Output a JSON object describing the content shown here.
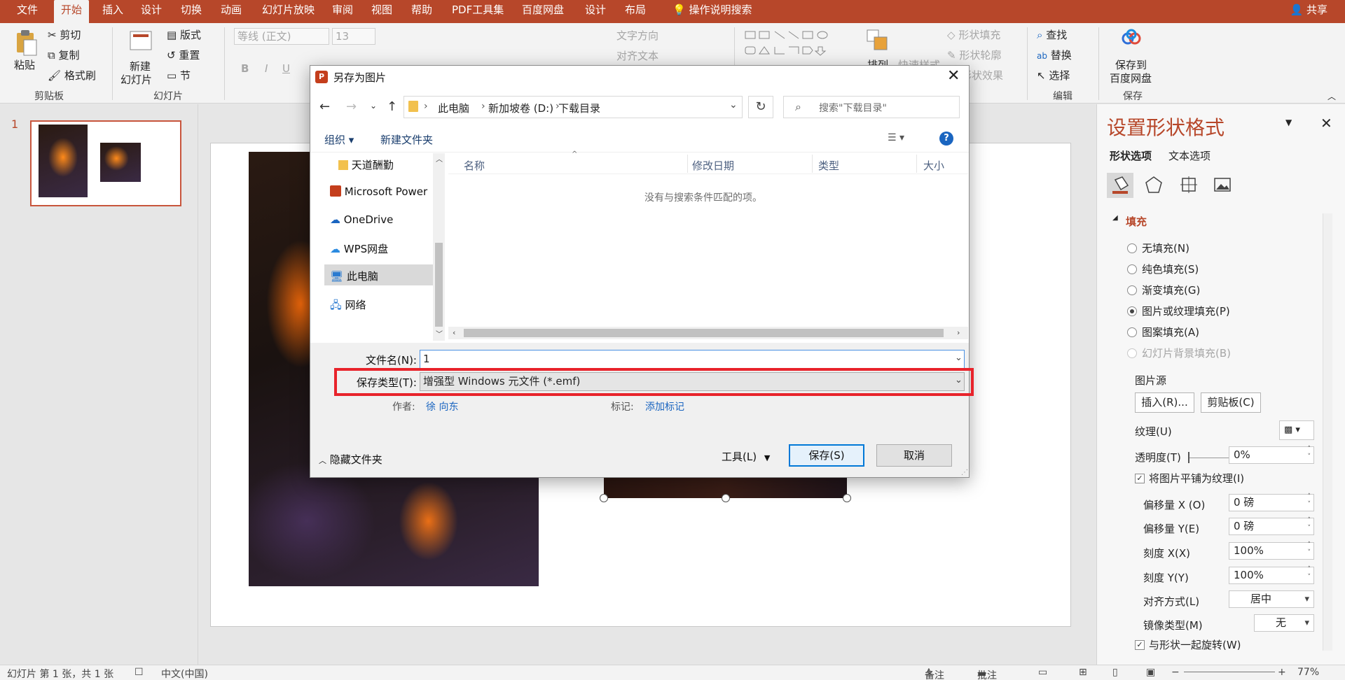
{
  "tabs": [
    "文件",
    "开始",
    "插入",
    "设计",
    "切换",
    "动画",
    "幻灯片放映",
    "审阅",
    "视图",
    "帮助",
    "PDF工具集",
    "百度网盘",
    "设计",
    "布局"
  ],
  "active_tab_index": 1,
  "tell_me": "操作说明搜索",
  "share": "共享",
  "ribbon": {
    "paste": "粘贴",
    "cut": "剪切",
    "copy": "复制",
    "format_painter": "格式刷",
    "clipboard_group": "剪贴板",
    "new_slide": "新建",
    "new_slide_2": "幻灯片",
    "layout": "版式",
    "reset": "重置",
    "section": "节",
    "slides_group": "幻灯片",
    "font_name": "等线 (正文)",
    "font_size": "13",
    "text_direction": "文字方向",
    "align_text": "对齐文本",
    "arrange": "排列",
    "quick_styles": "快速样式",
    "shape_fill": "形状填充",
    "shape_outline": "形状轮廓",
    "shape_effects": "形状效果",
    "find": "查找",
    "replace": "替换",
    "select": "选择",
    "editing_group": "编辑",
    "save_to_baidu_1": "保存到",
    "save_to_baidu_2": "百度网盘",
    "save_group": "保存"
  },
  "slide_number": "1",
  "dialog": {
    "title": "另存为图片",
    "breadcrumb": [
      "此电脑",
      "新加坡卷 (D:)",
      "下载目录"
    ],
    "search_placeholder": "搜索\"下载目录\"",
    "organize": "组织",
    "new_folder": "新建文件夹",
    "nav_items": [
      "天道酬勤",
      "Microsoft Power",
      "OneDrive",
      "WPS网盘",
      "此电脑",
      "网络"
    ],
    "columns": [
      "名称",
      "修改日期",
      "类型",
      "大小"
    ],
    "empty_message": "没有与搜索条件匹配的项。",
    "filename_label": "文件名(N):",
    "filename_value": "1",
    "filetype_label": "保存类型(T):",
    "filetype_value": "增强型 Windows 元文件 (*.emf)",
    "author_label": "作者:",
    "author_value": "徐 向东",
    "tags_label": "标记:",
    "tags_value": "添加标记",
    "hide_folders": "隐藏文件夹",
    "tools": "工具(L)",
    "save": "保存(S)",
    "cancel": "取消"
  },
  "format_pane": {
    "title": "设置形状格式",
    "tab_shape": "形状选项",
    "tab_text": "文本选项",
    "section_fill": "填充",
    "options": [
      "无填充(N)",
      "纯色填充(S)",
      "渐变填充(G)",
      "图片或纹理填充(P)",
      "图案填充(A)",
      "幻灯片背景填充(B)"
    ],
    "selected_option_index": 3,
    "picture_source": "图片源",
    "insert_btn": "插入(R)...",
    "clipboard_btn": "剪贴板(C)",
    "texture": "纹理(U)",
    "transparency": "透明度(T)",
    "transparency_value": "0%",
    "tile_checkbox": "将图片平铺为纹理(I)",
    "offset_x": "偏移量 X (O)",
    "offset_x_value": "0 磅",
    "offset_y": "偏移量 Y(E)",
    "offset_y_value": "0 磅",
    "scale_x": "刻度 X(X)",
    "scale_x_value": "100%",
    "scale_y": "刻度 Y(Y)",
    "scale_y_value": "100%",
    "alignment": "对齐方式(L)",
    "alignment_value": "居中",
    "mirror": "镜像类型(M)",
    "mirror_value": "无",
    "rotate_checkbox": "与形状一起旋转(W)"
  },
  "status": {
    "slide_info": "幻灯片 第 1 张，共 1 张",
    "language": "中文(中国)",
    "notes": "备注",
    "comments": "批注",
    "zoom": "77%"
  },
  "colors": {
    "accent": "#b7472a",
    "highlight": "#e8232b",
    "link": "#1a65c0"
  }
}
